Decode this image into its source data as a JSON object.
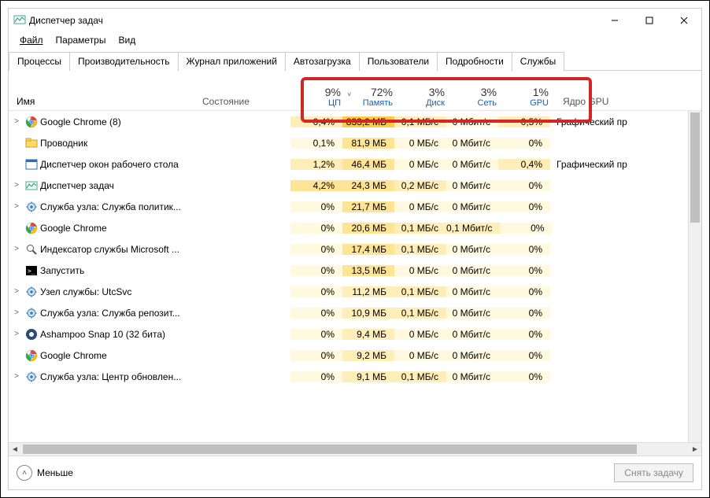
{
  "window": {
    "title": "Диспетчер задач",
    "controls": {
      "min": "minimize",
      "max": "maximize",
      "close": "close"
    }
  },
  "menu": {
    "file": "Файл",
    "options": "Параметры",
    "view": "Вид"
  },
  "tabs": {
    "processes": "Процессы",
    "performance": "Производительность",
    "app_history": "Журнал приложений",
    "startup": "Автозагрузка",
    "users": "Пользователи",
    "details": "Подробности",
    "services": "Службы"
  },
  "headers": {
    "name": "Имя",
    "state": "Состояние",
    "cpu": {
      "pct": "9%",
      "label": "ЦП"
    },
    "memory": {
      "pct": "72%",
      "label": "Память"
    },
    "disk": {
      "pct": "3%",
      "label": "Диск"
    },
    "network": {
      "pct": "3%",
      "label": "Сеть"
    },
    "gpu": {
      "pct": "1%",
      "label": "GPU"
    },
    "gpu_engine": "Ядро GPU"
  },
  "sort_indicator": "˅",
  "rows": [
    {
      "exp": true,
      "icon": "chrome",
      "name": "Google Chrome (8)",
      "cpu": "0,4%",
      "mem": "833,2 МБ",
      "disk": "0,1 МБ/с",
      "net": "0 Мбит/с",
      "gpu": "0,5%",
      "gpu_eng": "Графический пр",
      "tints": [
        "t1",
        "t4",
        "t1",
        "t0",
        "t1"
      ]
    },
    {
      "exp": false,
      "icon": "explorer",
      "name": "Проводник",
      "cpu": "0,1%",
      "mem": "81,9 МБ",
      "disk": "0 МБ/с",
      "net": "0 Мбит/с",
      "gpu": "0%",
      "gpu_eng": "",
      "tints": [
        "t0",
        "t2",
        "t0",
        "t0",
        "t0"
      ]
    },
    {
      "exp": false,
      "icon": "dwm",
      "name": "Диспетчер окон рабочего стола",
      "cpu": "1,2%",
      "mem": "46,4 МБ",
      "disk": "0 МБ/с",
      "net": "0 Мбит/с",
      "gpu": "0,4%",
      "gpu_eng": "Графический пр",
      "tints": [
        "t1",
        "t2",
        "t0",
        "t0",
        "t1"
      ]
    },
    {
      "exp": true,
      "icon": "taskmgr",
      "name": "Диспетчер задач",
      "cpu": "4,2%",
      "mem": "24,3 МБ",
      "disk": "0,2 МБ/с",
      "net": "0 Мбит/с",
      "gpu": "0%",
      "gpu_eng": "",
      "tints": [
        "t2",
        "t2",
        "t1",
        "t0",
        "t0"
      ]
    },
    {
      "exp": true,
      "icon": "service",
      "name": "Служба узла: Служба политик...",
      "cpu": "0%",
      "mem": "21,7 МБ",
      "disk": "0 МБ/с",
      "net": "0 Мбит/с",
      "gpu": "0%",
      "gpu_eng": "",
      "tints": [
        "t0",
        "t2",
        "t0",
        "t0",
        "t0"
      ]
    },
    {
      "exp": false,
      "icon": "chrome",
      "name": "Google Chrome",
      "cpu": "0%",
      "mem": "20,6 МБ",
      "disk": "0,1 МБ/с",
      "net": "0,1 Мбит/с",
      "gpu": "0%",
      "gpu_eng": "",
      "tints": [
        "t0",
        "t2",
        "t1",
        "t1",
        "t0"
      ]
    },
    {
      "exp": true,
      "icon": "indexer",
      "name": "Индексатор службы Microsoft ...",
      "cpu": "0%",
      "mem": "17,4 МБ",
      "disk": "0,1 МБ/с",
      "net": "0 Мбит/с",
      "gpu": "0%",
      "gpu_eng": "",
      "tints": [
        "t0",
        "t2",
        "t1",
        "t0",
        "t0"
      ]
    },
    {
      "exp": false,
      "icon": "cmd",
      "name": "Запустить",
      "cpu": "0%",
      "mem": "13,5 МБ",
      "disk": "0 МБ/с",
      "net": "0 Мбит/с",
      "gpu": "0%",
      "gpu_eng": "",
      "tints": [
        "t0",
        "t2",
        "t0",
        "t0",
        "t0"
      ]
    },
    {
      "exp": true,
      "icon": "service",
      "name": "Узел службы: UtcSvc",
      "cpu": "0%",
      "mem": "11,2 МБ",
      "disk": "0,1 МБ/с",
      "net": "0 Мбит/с",
      "gpu": "0%",
      "gpu_eng": "",
      "tints": [
        "t0",
        "t1",
        "t1",
        "t0",
        "t0"
      ]
    },
    {
      "exp": true,
      "icon": "service",
      "name": "Служба узла: Служба репозит...",
      "cpu": "0%",
      "mem": "10,9 МБ",
      "disk": "0,1 МБ/с",
      "net": "0 Мбит/с",
      "gpu": "0%",
      "gpu_eng": "",
      "tints": [
        "t0",
        "t1",
        "t1",
        "t0",
        "t0"
      ]
    },
    {
      "exp": true,
      "icon": "ashampoo",
      "name": "Ashampoo Snap 10 (32 бита)",
      "cpu": "0%",
      "mem": "9,4 МБ",
      "disk": "0 МБ/с",
      "net": "0 Мбит/с",
      "gpu": "0%",
      "gpu_eng": "",
      "tints": [
        "t0",
        "t1",
        "t0",
        "t0",
        "t0"
      ]
    },
    {
      "exp": false,
      "icon": "chrome",
      "name": "Google Chrome",
      "cpu": "0%",
      "mem": "9,2 МБ",
      "disk": "0 МБ/с",
      "net": "0 Мбит/с",
      "gpu": "0%",
      "gpu_eng": "",
      "tints": [
        "t0",
        "t1",
        "t0",
        "t0",
        "t0"
      ]
    },
    {
      "exp": true,
      "icon": "service",
      "name": "Служба узла: Центр обновлен...",
      "cpu": "0%",
      "mem": "9,1 МБ",
      "disk": "0,1 МБ/с",
      "net": "0 Мбит/с",
      "gpu": "0%",
      "gpu_eng": "",
      "tints": [
        "t0",
        "t1",
        "t1",
        "t0",
        "t0"
      ]
    }
  ],
  "footer": {
    "less": "Меньше",
    "end_task": "Снять задачу"
  }
}
